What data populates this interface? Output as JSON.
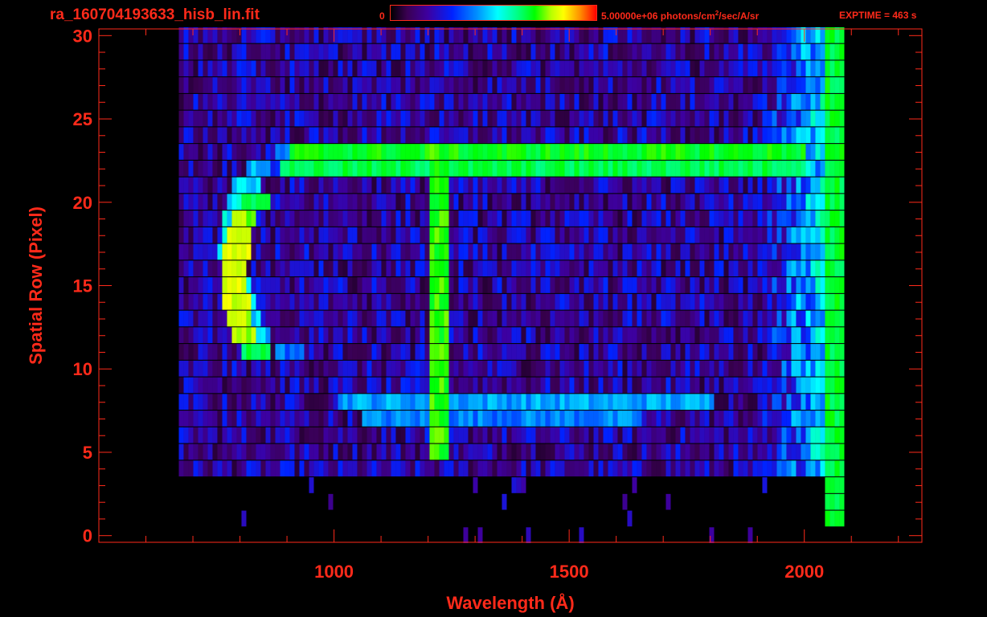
{
  "header": {
    "file_title": "ra_160704193633_hisb_lin.fit",
    "colorbar_min": "0",
    "colorbar_max_prefix": "5.00000e+06 photons/cm",
    "colorbar_max_exp": "2",
    "colorbar_max_suffix": "/sec/A/sr",
    "exptime": "EXPTIME = 463 s"
  },
  "colors": {
    "axis": "#ff2a1a",
    "background": "#000000",
    "colormap": [
      "#000000",
      "#3a0052",
      "#3d00a0",
      "#0022ff",
      "#0090ff",
      "#00ffff",
      "#00ff80",
      "#00ff00",
      "#b8ff00",
      "#ffff00",
      "#ff9000",
      "#ff0000"
    ]
  },
  "chart_data": {
    "type": "heatmap",
    "title": "ra_160704193633_hisb_lin.fit",
    "xlabel": "Wavelength (Å)",
    "ylabel": "Spatial Row (Pixel)",
    "xlim": [
      500,
      2250
    ],
    "ylim": [
      -0.4,
      30.4
    ],
    "xticks": [
      1000,
      1500,
      2000
    ],
    "yticks": [
      0,
      5,
      10,
      15,
      20,
      25,
      30
    ],
    "x_minor_step": 100,
    "y_minor_step": 1,
    "colorbar": {
      "min": 0,
      "max": 5000000,
      "units": "photons/cm^2/sec/A/sr"
    },
    "rows": 31,
    "noise_extent_x": [
      670,
      2075
    ],
    "noise_extent_y": [
      4,
      30
    ],
    "features": [
      {
        "kind": "bright_row",
        "y": 23,
        "x_range": [
          900,
          2000
        ],
        "level": 0.62
      },
      {
        "kind": "bright_row",
        "y": 22,
        "x_range": [
          880,
          2000
        ],
        "level": 0.58
      },
      {
        "kind": "bright_column",
        "x": 1216,
        "y_range": [
          5,
          23
        ],
        "level": 0.65
      },
      {
        "kind": "arc",
        "center_x": 830,
        "center_y": 16.5,
        "x_radius": 45,
        "y_range": [
          11,
          20
        ],
        "level": 0.78
      },
      {
        "kind": "arc",
        "center_x": 900,
        "center_y": 17,
        "x_radius": 120,
        "y_range": [
          11,
          23
        ],
        "level": 0.45
      },
      {
        "kind": "bright_row",
        "y": 8,
        "x_range": [
          1000,
          1800
        ],
        "level": 0.38
      },
      {
        "kind": "bright_row",
        "y": 7,
        "x_range": [
          1050,
          1650
        ],
        "level": 0.35
      },
      {
        "kind": "bright_column",
        "x": 2060,
        "y_range": [
          1,
          30
        ],
        "level": 0.6
      }
    ]
  }
}
